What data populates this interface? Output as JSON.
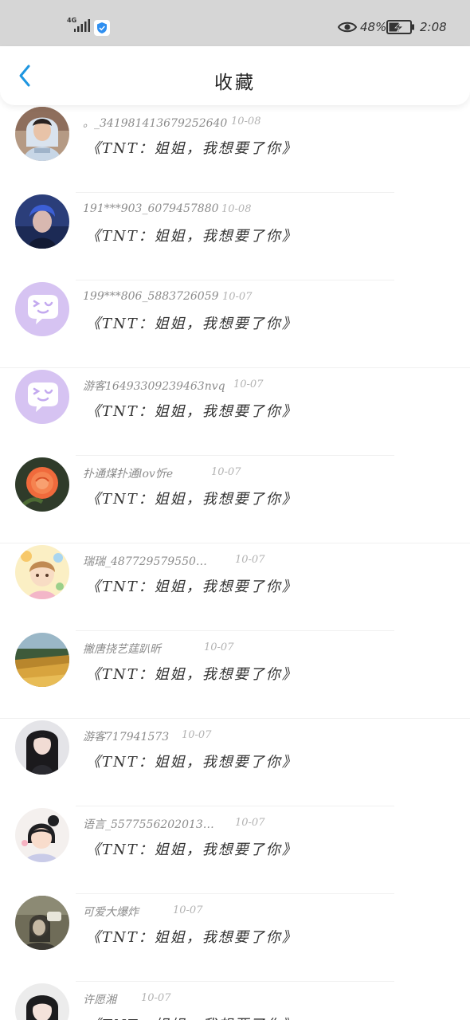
{
  "status_bar": {
    "network": "4G",
    "battery_percent": "48%",
    "time": "2:08"
  },
  "nav": {
    "title": "收藏",
    "back_icon": "chevron-left-icon"
  },
  "colors": {
    "accent": "#1e96e0",
    "status_bar_bg": "#d6d6d6",
    "username": "#8c8c8c",
    "date": "#b3b3b3"
  },
  "items": [
    {
      "name": "。_341981413679252640",
      "date": "10-08",
      "content": "《TNT：姐姐，我想要了你》",
      "avatar": "boy-in-hoodie"
    },
    {
      "name": "191***903_6079457880",
      "date": "10-08",
      "content": "《TNT：姐姐，我想要了你》",
      "avatar": "boy-blue-hair"
    },
    {
      "name": "199***806_5883726059",
      "date": "10-07",
      "content": "《TNT：姐姐，我想要了你》",
      "avatar": "default-chat-bubble"
    },
    {
      "name": "游客16493309239463nvq",
      "date": "10-07",
      "content": "《TNT：姐姐，我想要了你》",
      "avatar": "default-chat-bubble"
    },
    {
      "name": "扑通煤扑通lov忻e",
      "date": "10-07",
      "content": "《TNT：姐姐，我想要了你》",
      "avatar": "orange-rose"
    },
    {
      "name": "瑞瑞_487729579550…",
      "date": "10-07",
      "content": "《TNT：姐姐，我想要了你》",
      "avatar": "cartoon-girl"
    },
    {
      "name": "撇唐挠艺莛趴昕",
      "date": "10-07",
      "content": "《TNT：姐姐，我想要了你》",
      "avatar": "wheat-field"
    },
    {
      "name": "游客717941573",
      "date": "10-07",
      "content": "《TNT：姐姐，我想要了你》",
      "avatar": "dark-hair-girl"
    },
    {
      "name": "语言_5577556202013…",
      "date": "10-07",
      "content": "《TNT：姐姐，我想要了你》",
      "avatar": "cartoon-girl-bun"
    },
    {
      "name": "可爱大爆炸",
      "date": "10-07",
      "content": "《TNT：姐姐，我想要了你》",
      "avatar": "photo-selfie"
    },
    {
      "name": "许愿湘",
      "date": "10-07",
      "content": "《TNT：姐姐，我想要了你》",
      "avatar": "girl-portrait"
    }
  ]
}
